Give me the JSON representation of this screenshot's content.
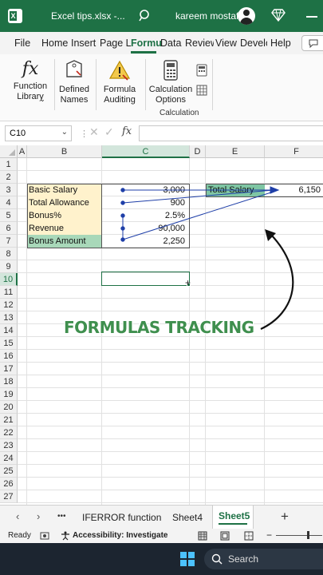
{
  "titlebar": {
    "filename": "Excel tips.xlsx  -...",
    "user": "kareem mostafa"
  },
  "tabs": [
    "File",
    "Home",
    "Insert",
    "Page L",
    "Formu",
    "Data",
    "Review",
    "View",
    "Develo",
    "Help"
  ],
  "ribbon": {
    "function_library": "Function\nLibrary",
    "defined_names": "Defined\nNames",
    "formula_auditing": "Formula\nAuditing",
    "calc_options": "Calculation\nOptions",
    "group_label": "Calculation",
    "fx_glyph": "fx"
  },
  "formula_bar": {
    "name_box": "C10",
    "fx": "fx",
    "formula": ""
  },
  "columns": [
    "A",
    "B",
    "C",
    "D",
    "E",
    "F"
  ],
  "rows": [
    "1",
    "2",
    "3",
    "4",
    "5",
    "6",
    "7",
    "8",
    "9",
    "10",
    "11",
    "12",
    "13",
    "14",
    "15",
    "16",
    "17",
    "18",
    "19",
    "20",
    "21",
    "22",
    "23",
    "24",
    "25",
    "26",
    "27"
  ],
  "cells": {
    "B3": "Basic Salary",
    "C3": "3,000",
    "B4": "Total Allowance",
    "C4": "900",
    "B5": "Bonus%",
    "C5": "2.5%",
    "B6": "Revenue",
    "C6": "90,000",
    "B7": "Bonus Amount",
    "C7": "2,250",
    "E3": "Total Salary",
    "F3": "6,150"
  },
  "overlay_text": "FORMULAS TRACKING",
  "sheet_tabs": {
    "overflow": "•••",
    "tab1": "IFERROR function",
    "tab2": "Sheet4",
    "tab3": "Sheet5",
    "add": "+"
  },
  "status": {
    "ready": "Ready",
    "accessibility": "Accessibility: Investigate"
  },
  "taskbar": {
    "search": "Search"
  },
  "colors": {
    "accent": "#1e7145",
    "yellow": "#fff2cc",
    "green": "#a8d8b9",
    "trace": "#1f3fa8"
  }
}
